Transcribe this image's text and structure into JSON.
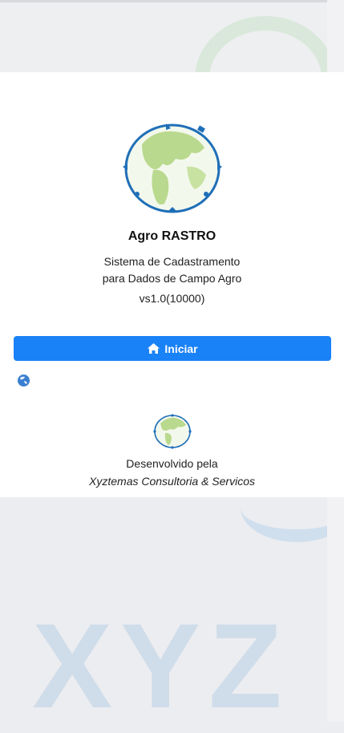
{
  "app": {
    "name": "Agro RASTRO",
    "subtitle_line1": "Sistema de Cadastramento",
    "subtitle_line2": "para Dados de Campo Agro",
    "version": "vs1.0(10000)"
  },
  "actions": {
    "start_label": "Iniciar"
  },
  "footer": {
    "developed_by": "Desenvolvido pela",
    "company": "Xyztemas Consultoria & Servicos"
  },
  "background": {
    "watermark": "XYZ"
  },
  "colors": {
    "accent": "#1a82f7",
    "globe_land": "#b9d98e",
    "globe_ring": "#1f6fb8"
  },
  "icons": {
    "start": "home-icon",
    "logo": "globe-logo-icon",
    "small": "globe-icon"
  }
}
